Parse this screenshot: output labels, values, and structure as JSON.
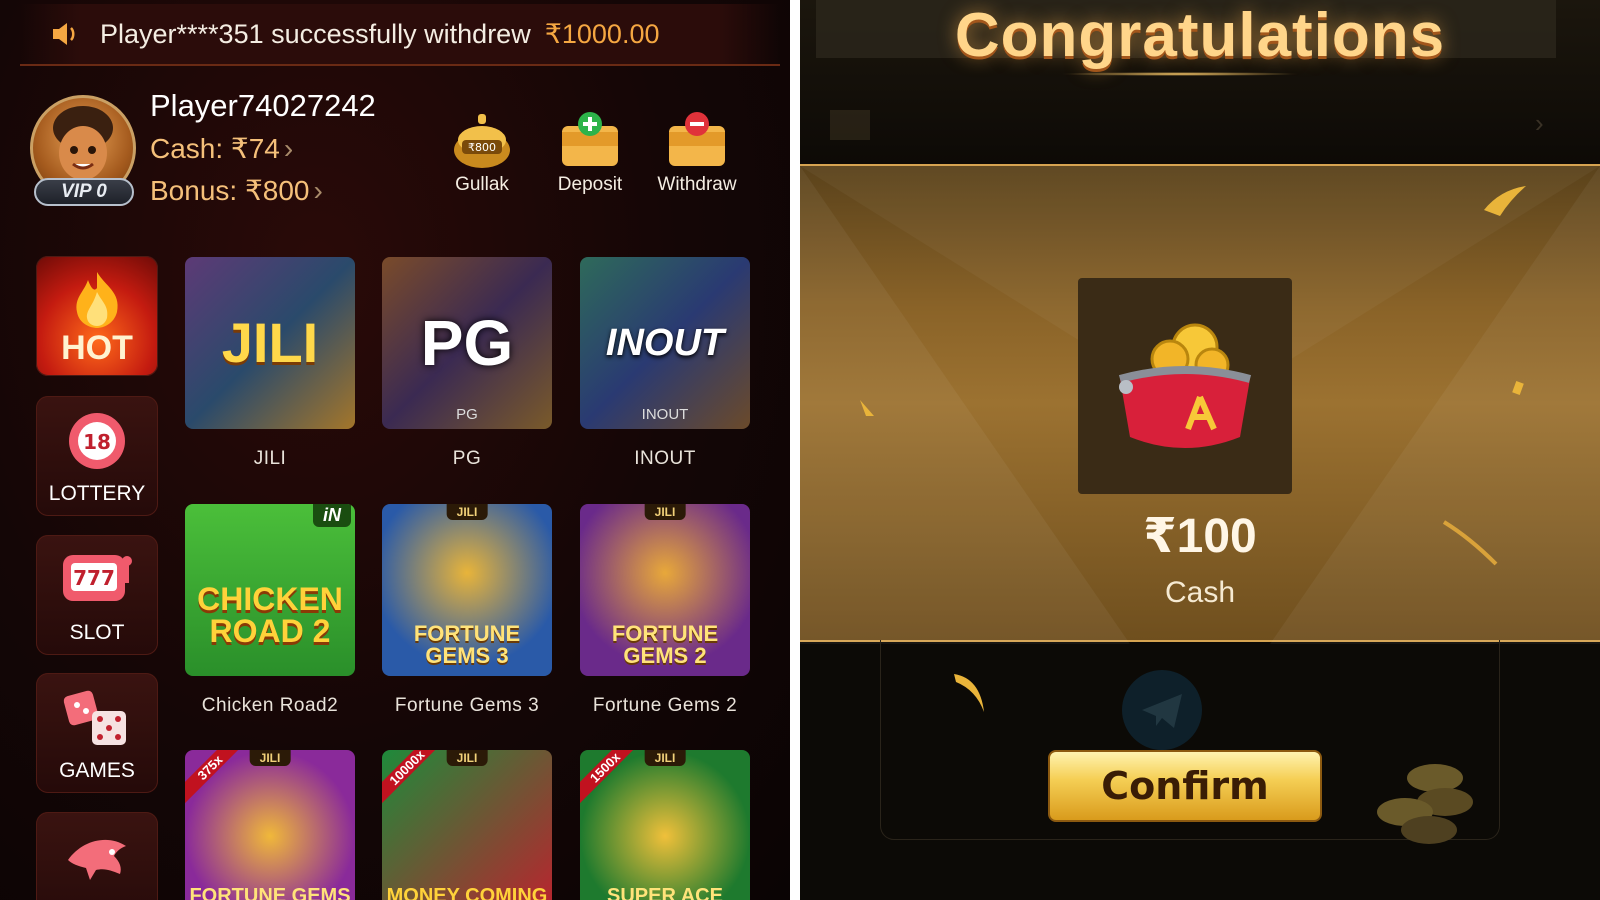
{
  "left": {
    "marquee": {
      "icon": "speaker-icon",
      "message": "Player****351 successfully withdrew",
      "amount": "₹1000.00"
    },
    "profile": {
      "name": "Player74027242",
      "vip": "VIP 0",
      "cash": "Cash: ₹74",
      "bonus": "Bonus: ₹800",
      "chevron": "›"
    },
    "actions": [
      {
        "label": "Gullak",
        "badge": "₹800",
        "icon": "piggy-bank-icon"
      },
      {
        "label": "Deposit",
        "icon": "wallet-plus-icon"
      },
      {
        "label": "Withdraw",
        "icon": "wallet-minus-icon"
      }
    ],
    "side_nav": [
      {
        "label": "HOT",
        "icon": "flame-icon"
      },
      {
        "label": "LOTTERY",
        "badge": "18",
        "icon": "lottery-ball-icon"
      },
      {
        "label": "SLOT",
        "badge": "777",
        "icon": "slot-machine-icon"
      },
      {
        "label": "GAMES",
        "icon": "dice-icon"
      },
      {
        "label": "",
        "icon": "shark-icon"
      }
    ],
    "providers": [
      {
        "label": "JILI",
        "logo": "JILI",
        "sub": ""
      },
      {
        "label": "PG",
        "logo": "PG",
        "sub": "PG"
      },
      {
        "label": "INOUT",
        "logo": "INOUT",
        "sub": "INOUT"
      }
    ],
    "games": [
      {
        "label": "Chicken Road2",
        "logo": "CHICKEN ROAD 2",
        "tag": "iN"
      },
      {
        "label": "Fortune Gems 3",
        "logo": "FORTUNE GEMS 3",
        "tag": "JILI"
      },
      {
        "label": "Fortune Gems 2",
        "logo": "FORTUNE GEMS 2",
        "tag": "JILI"
      }
    ],
    "games_row3": [
      {
        "logo": "FORTUNE GEMS",
        "tag": "JILI",
        "mult": "375x"
      },
      {
        "logo": "MONEY COMING",
        "tag": "JILI",
        "mult": "10000x"
      },
      {
        "logo": "SUPER ACE",
        "tag": "JILI",
        "mult": "1500x"
      }
    ]
  },
  "right": {
    "title": "Congratulations",
    "reward_amount": "₹100",
    "reward_type": "Cash",
    "confirm_label": "Confirm",
    "reward_icon": "coin-purse-icon"
  }
}
